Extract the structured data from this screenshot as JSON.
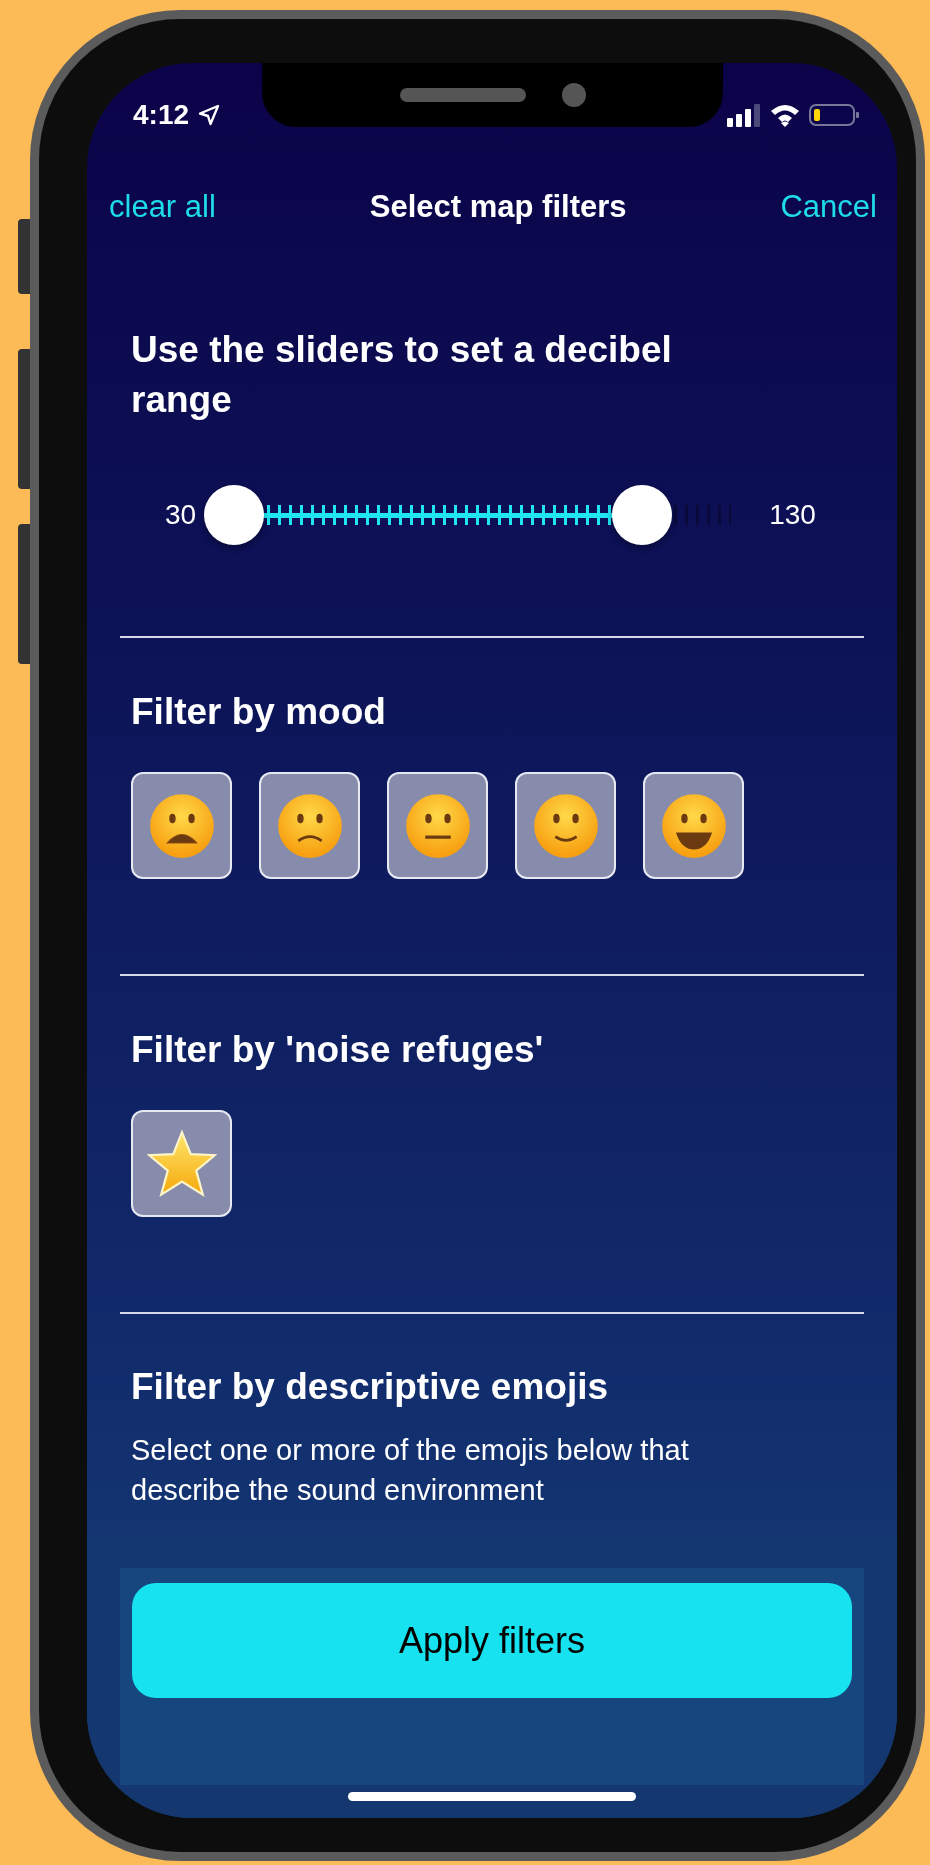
{
  "status_bar": {
    "time": "4:12"
  },
  "nav": {
    "left": "clear all",
    "title": "Select map filters",
    "right": "Cancel"
  },
  "decibel": {
    "heading": "Use the sliders to set a decibel range",
    "min_label": "30",
    "max_label": "130",
    "low_thumb": {
      "level": 0
    },
    "high_thumb": {
      "level": 0.82
    }
  },
  "mood": {
    "heading": "Filter by mood",
    "options": [
      {
        "kind": "anguished",
        "selected": false
      },
      {
        "kind": "frowning",
        "selected": false
      },
      {
        "kind": "neutral",
        "selected": false
      },
      {
        "kind": "smiling",
        "selected": false
      },
      {
        "kind": "grinning",
        "selected": false
      }
    ]
  },
  "refuges": {
    "heading": "Filter by 'noise refuges'",
    "options": [
      {
        "kind": "star",
        "selected": false
      }
    ]
  },
  "descriptive": {
    "heading": "Filter by descriptive emojis",
    "text": "Select one or more of the emojis below that describe the sound environment"
  },
  "apply_button": "Apply filters"
}
